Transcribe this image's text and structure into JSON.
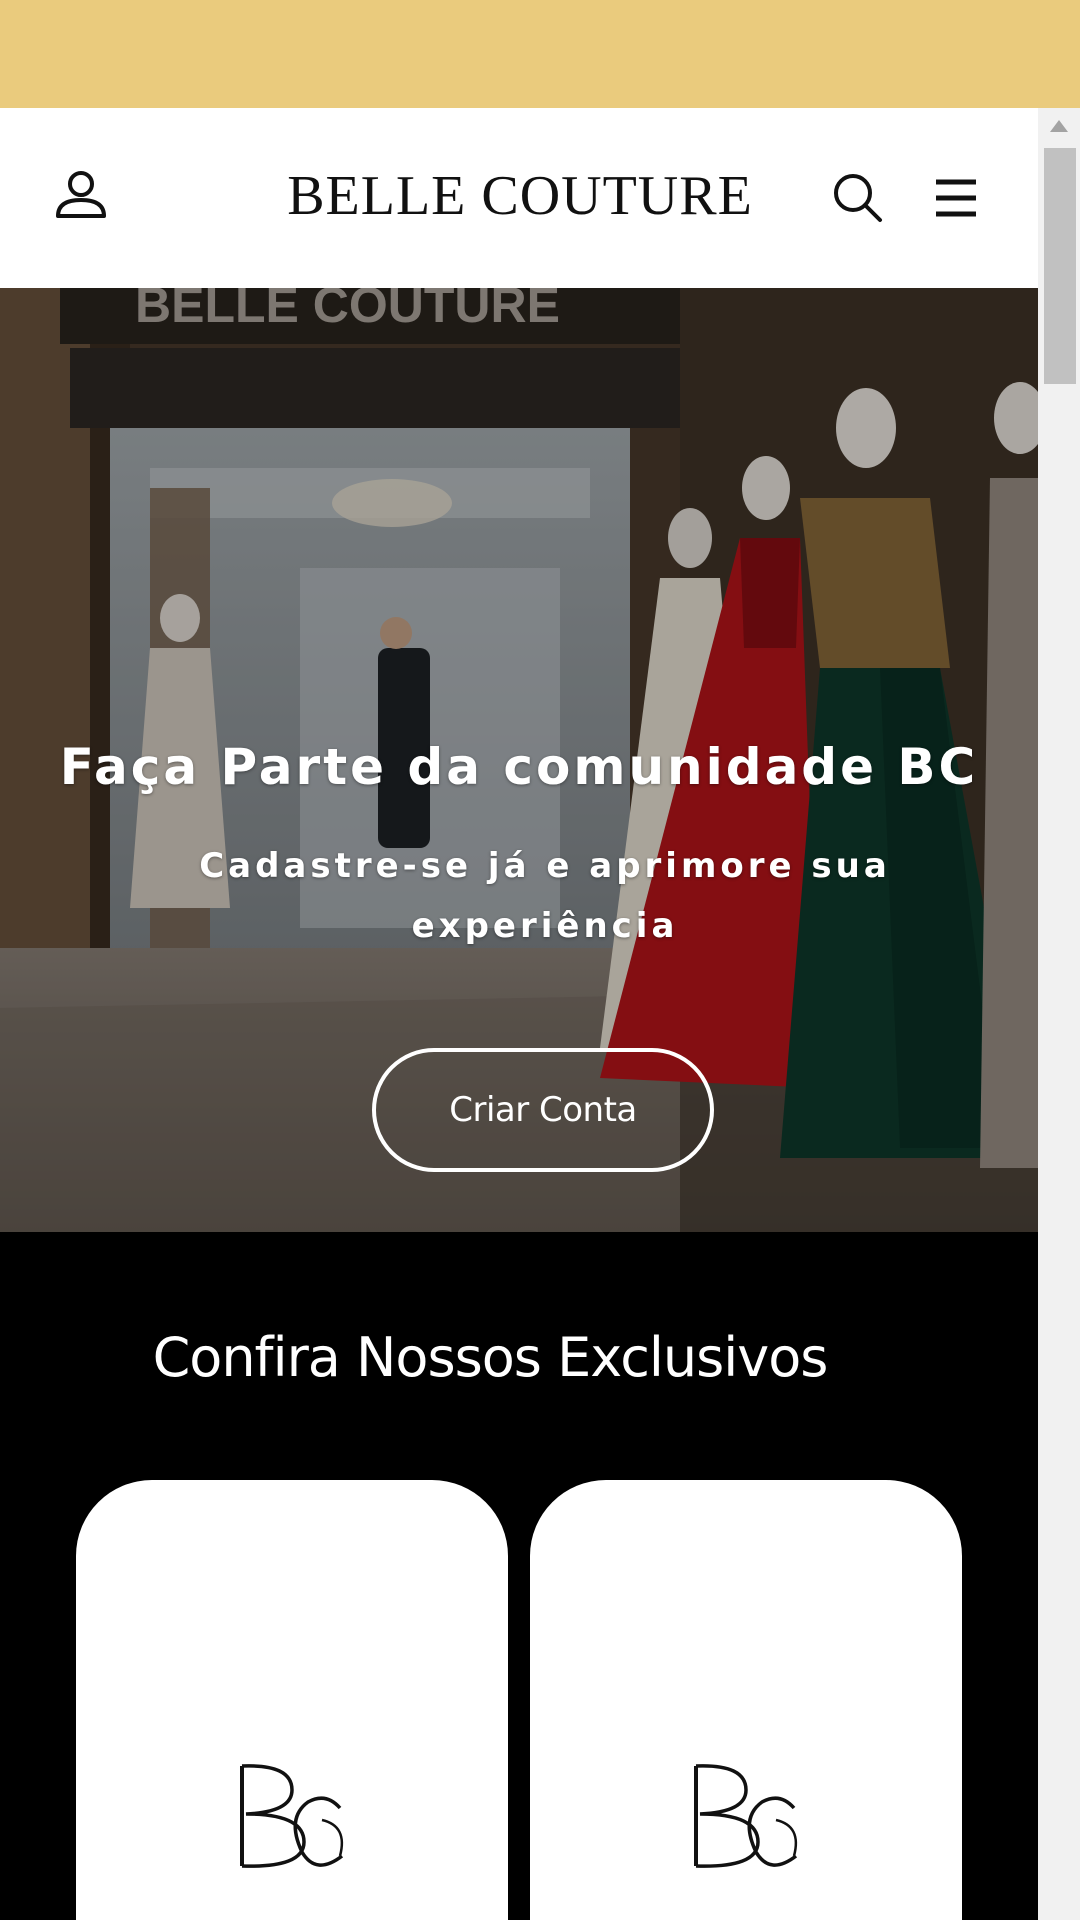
{
  "header": {
    "brand": "BELLE COUTURE",
    "account_icon": "user-icon",
    "search_icon": "search-icon",
    "menu_icon": "hamburger-menu-icon"
  },
  "hero": {
    "storefront_sign": "BELLE COUTURE",
    "title": "Faça Parte da comunidade BC",
    "subtitle": "Cadastre-se já e aprimore sua experiência",
    "cta_label": "Criar Conta"
  },
  "exclusives": {
    "title": "Confira Nossos Exclusivos",
    "cards": [
      {
        "logo": "BC"
      },
      {
        "logo": "BC"
      }
    ]
  },
  "colors": {
    "banner": "#eacb7d",
    "header_bg": "#ffffff",
    "section_bg": "#000000",
    "card_bg": "#ffffff"
  }
}
